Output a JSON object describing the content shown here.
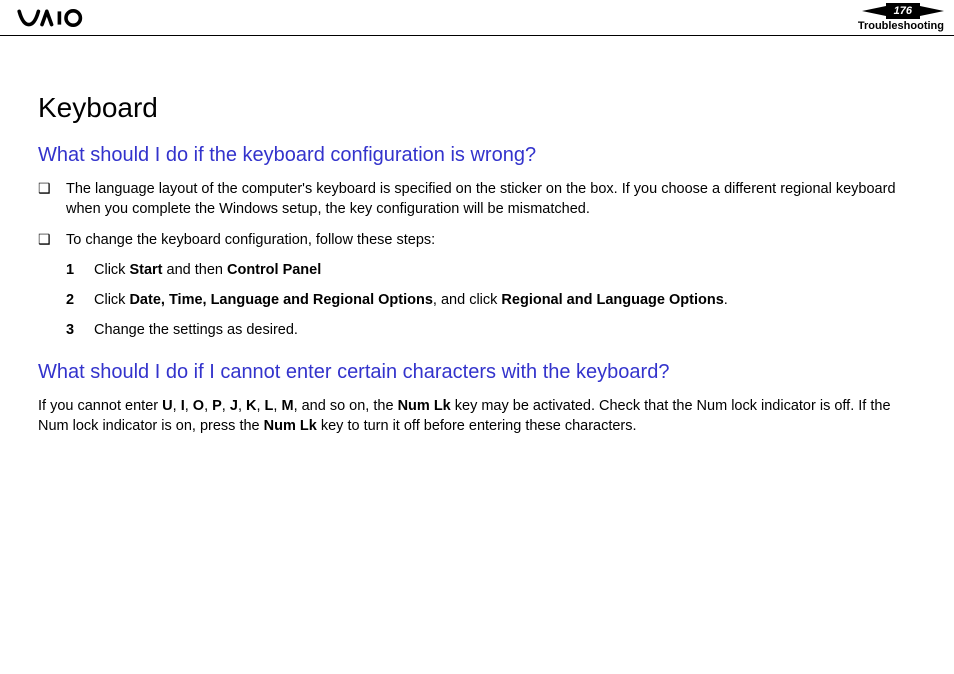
{
  "header": {
    "page_number": "176",
    "section": "Troubleshooting"
  },
  "content": {
    "title": "Keyboard",
    "q1": {
      "heading": "What should I do if the keyboard configuration is wrong?",
      "bullet1": "The language layout of the computer's keyboard is specified on the sticker on the box. If you choose a different regional keyboard when you complete the Windows setup, the key configuration will be mismatched.",
      "bullet2": "To change the keyboard configuration, follow these steps:",
      "steps": {
        "s1": {
          "n": "1",
          "pre": "Click ",
          "b1": "Start",
          "mid": " and then ",
          "b2": "Control Panel",
          "post": ""
        },
        "s2": {
          "n": "2",
          "pre": "Click ",
          "b1": "Date, Time, Language and Regional Options",
          "mid": ", and click ",
          "b2": "Regional and Language Options",
          "post": "."
        },
        "s3": {
          "n": "3",
          "text": "Change the settings as desired."
        }
      }
    },
    "q2": {
      "heading": "What should I do if I cannot enter certain characters with the keyboard?",
      "para": {
        "t1": "If you cannot enter ",
        "kU": "U",
        "c1": ", ",
        "kI": "I",
        "c2": ", ",
        "kO": "O",
        "c3": ", ",
        "kP": "P",
        "c4": ", ",
        "kJ": "J",
        "c5": ", ",
        "kK": "K",
        "c6": ", ",
        "kL": "L",
        "c7": ", ",
        "kM": "M",
        "t2": ", and so on, the ",
        "numlk1": "Num Lk",
        "t3": " key may be activated. Check that the Num lock indicator is off. If the Num lock indicator is on, press the ",
        "numlk2": "Num Lk",
        "t4": " key to turn it off before entering these characters."
      }
    }
  }
}
